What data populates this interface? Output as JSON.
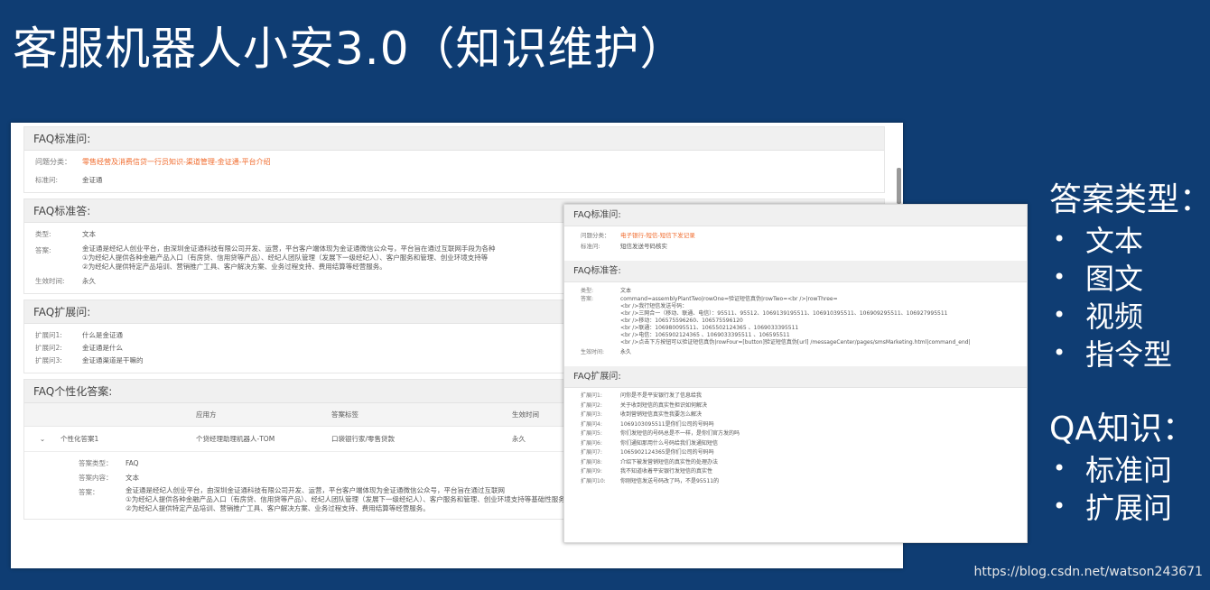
{
  "title": "客服机器人小安3.0（知识维护）",
  "main_panel": {
    "faq_std_q": {
      "header": "FAQ标准问:",
      "category_label": "问题分类：",
      "category": "零售经营及消费信贷一行员知识-渠道管理-金证通-平台介绍",
      "std_q_label": "标准问:",
      "std_q": "金证通"
    },
    "faq_std_a": {
      "header": "FAQ标准答:",
      "type_label": "类型:",
      "type": "文本",
      "answer_label": "答案:",
      "answer": "金证通是经纪人创业平台，由深圳金证通科技有限公司开发、运营，平台客户端体现为金证通微信公众号，平台旨在通过互联网手段为各种\n①为经纪人提供各种金融产品入口（有房贷、信用贷等产品）、经纪人团队管理（发展下一级经纪人）、客户服务和管理、创业环境支持等\n②为经纪人提供特定产品培训、营销推广工具、客户解决方案、业务过程支持、费用结算等经营服务。",
      "valid_label": "生效时间:",
      "valid": "永久"
    },
    "faq_ext_q": {
      "header": "FAQ扩展问:",
      "items": [
        {
          "label": "扩展问1:",
          "value": "什么是金证通"
        },
        {
          "label": "扩展问2:",
          "value": "金证通是什么"
        },
        {
          "label": "扩展问3:",
          "value": "金证通渠道是干嘛的"
        }
      ]
    },
    "faq_personal": {
      "header": "FAQ个性化答案:",
      "columns": [
        "",
        "",
        "应用方",
        "答案标签",
        "生效时间"
      ],
      "row": [
        "⌄",
        "个性化答案1",
        "个贷经理助理机器人-TOM",
        "口袋银行家/零售贷款",
        "永久"
      ],
      "detail": {
        "type_label": "答案类型：",
        "type": "FAQ",
        "content_label": "答案内容：",
        "content": "文本",
        "answer_label": "答案：",
        "answer": "金证通是经纪人创业平台，由深圳金证通科技有限公司开发、运营，平台客户端体现为金证通微信公众号，平台旨在通过互联网\n①为经纪人提供各种金融产品入口（有房贷、信用贷等产品）、经纪人团队管理（发展下一级经纪人）、客户服务和管理、创业环境支持等基础性服务。\n②为经纪人提供特定产品培训、营销推广工具、客户解决方案、业务过程支持、费用结算等经营服务。"
      }
    }
  },
  "overlay_panel": {
    "faq_std_q": {
      "header": "FAQ标准问:",
      "category_label": "问题分类：",
      "category": "电子银行-短信-短信下发记录",
      "std_q_label": "标准问:",
      "std_q": "短信发送号码核实"
    },
    "faq_std_a": {
      "header": "FAQ标准答:",
      "type_label": "类型:",
      "type": "文本",
      "answer_label": "答案:",
      "answer": "command=assemblyPlantTwo|rowOne=验证短信真伪|rowTwo=<br />|rowThree=\n<br />我行短信发送号码：\n<br />三网合一（移动、联通、电信）：95511、95512、1069139195511、106910395511、106909295511、106927995511\n<br />移动：106575596260、106575596120\n<br />联通：106980095511、1065502124365 、1069033395511\n<br />电信：1065902124365 、1069033395511 、106595511\n<br />点击下方按钮可以验证短信真伪|rowFour=[button]验证短信真伪[url] /messageCenter/pages/smsMarketing.html|command_end|",
      "valid_label": "生效时间:",
      "valid": "永久"
    },
    "faq_ext_q": {
      "header": "FAQ扩展问:",
      "items": [
        {
          "label": "扩展问1:",
          "value": "问你是不是平安银行发了信息给我"
        },
        {
          "label": "扩展问2:",
          "value": "关于收到短信的真实性担识如何解决"
        },
        {
          "label": "扩展问3:",
          "value": "收到营销短信真实性我要怎么解决"
        },
        {
          "label": "扩展问4:",
          "value": "1069103095511是你们公司的号码吗"
        },
        {
          "label": "扩展问5:",
          "value": "你们发短信的号码总是不一样，是你们官方发的吗"
        },
        {
          "label": "扩展问6:",
          "value": "你们通知那用什么号码给我们发通知短信"
        },
        {
          "label": "扩展问7:",
          "value": "1065902124365是你们公司的号码吗"
        },
        {
          "label": "扩展问8:",
          "value": "介绍下被发营销短信的真实性的处理办法"
        },
        {
          "label": "扩展问9:",
          "value": "我不知道收着平安银行发短信的真实性"
        },
        {
          "label": "扩展问10:",
          "value": "你刚短信发送号码改了吗，不是95511的"
        }
      ]
    }
  },
  "right_panel": {
    "answer_types_title": "答案类型：",
    "answer_types": [
      "文本",
      "图文",
      "视频",
      "指令型"
    ],
    "qa_title": "QA知识：",
    "qa_items": [
      "标准问",
      "扩展问"
    ],
    "bullet": "•"
  },
  "watermark": "https://blog.csdn.net/watson243671"
}
